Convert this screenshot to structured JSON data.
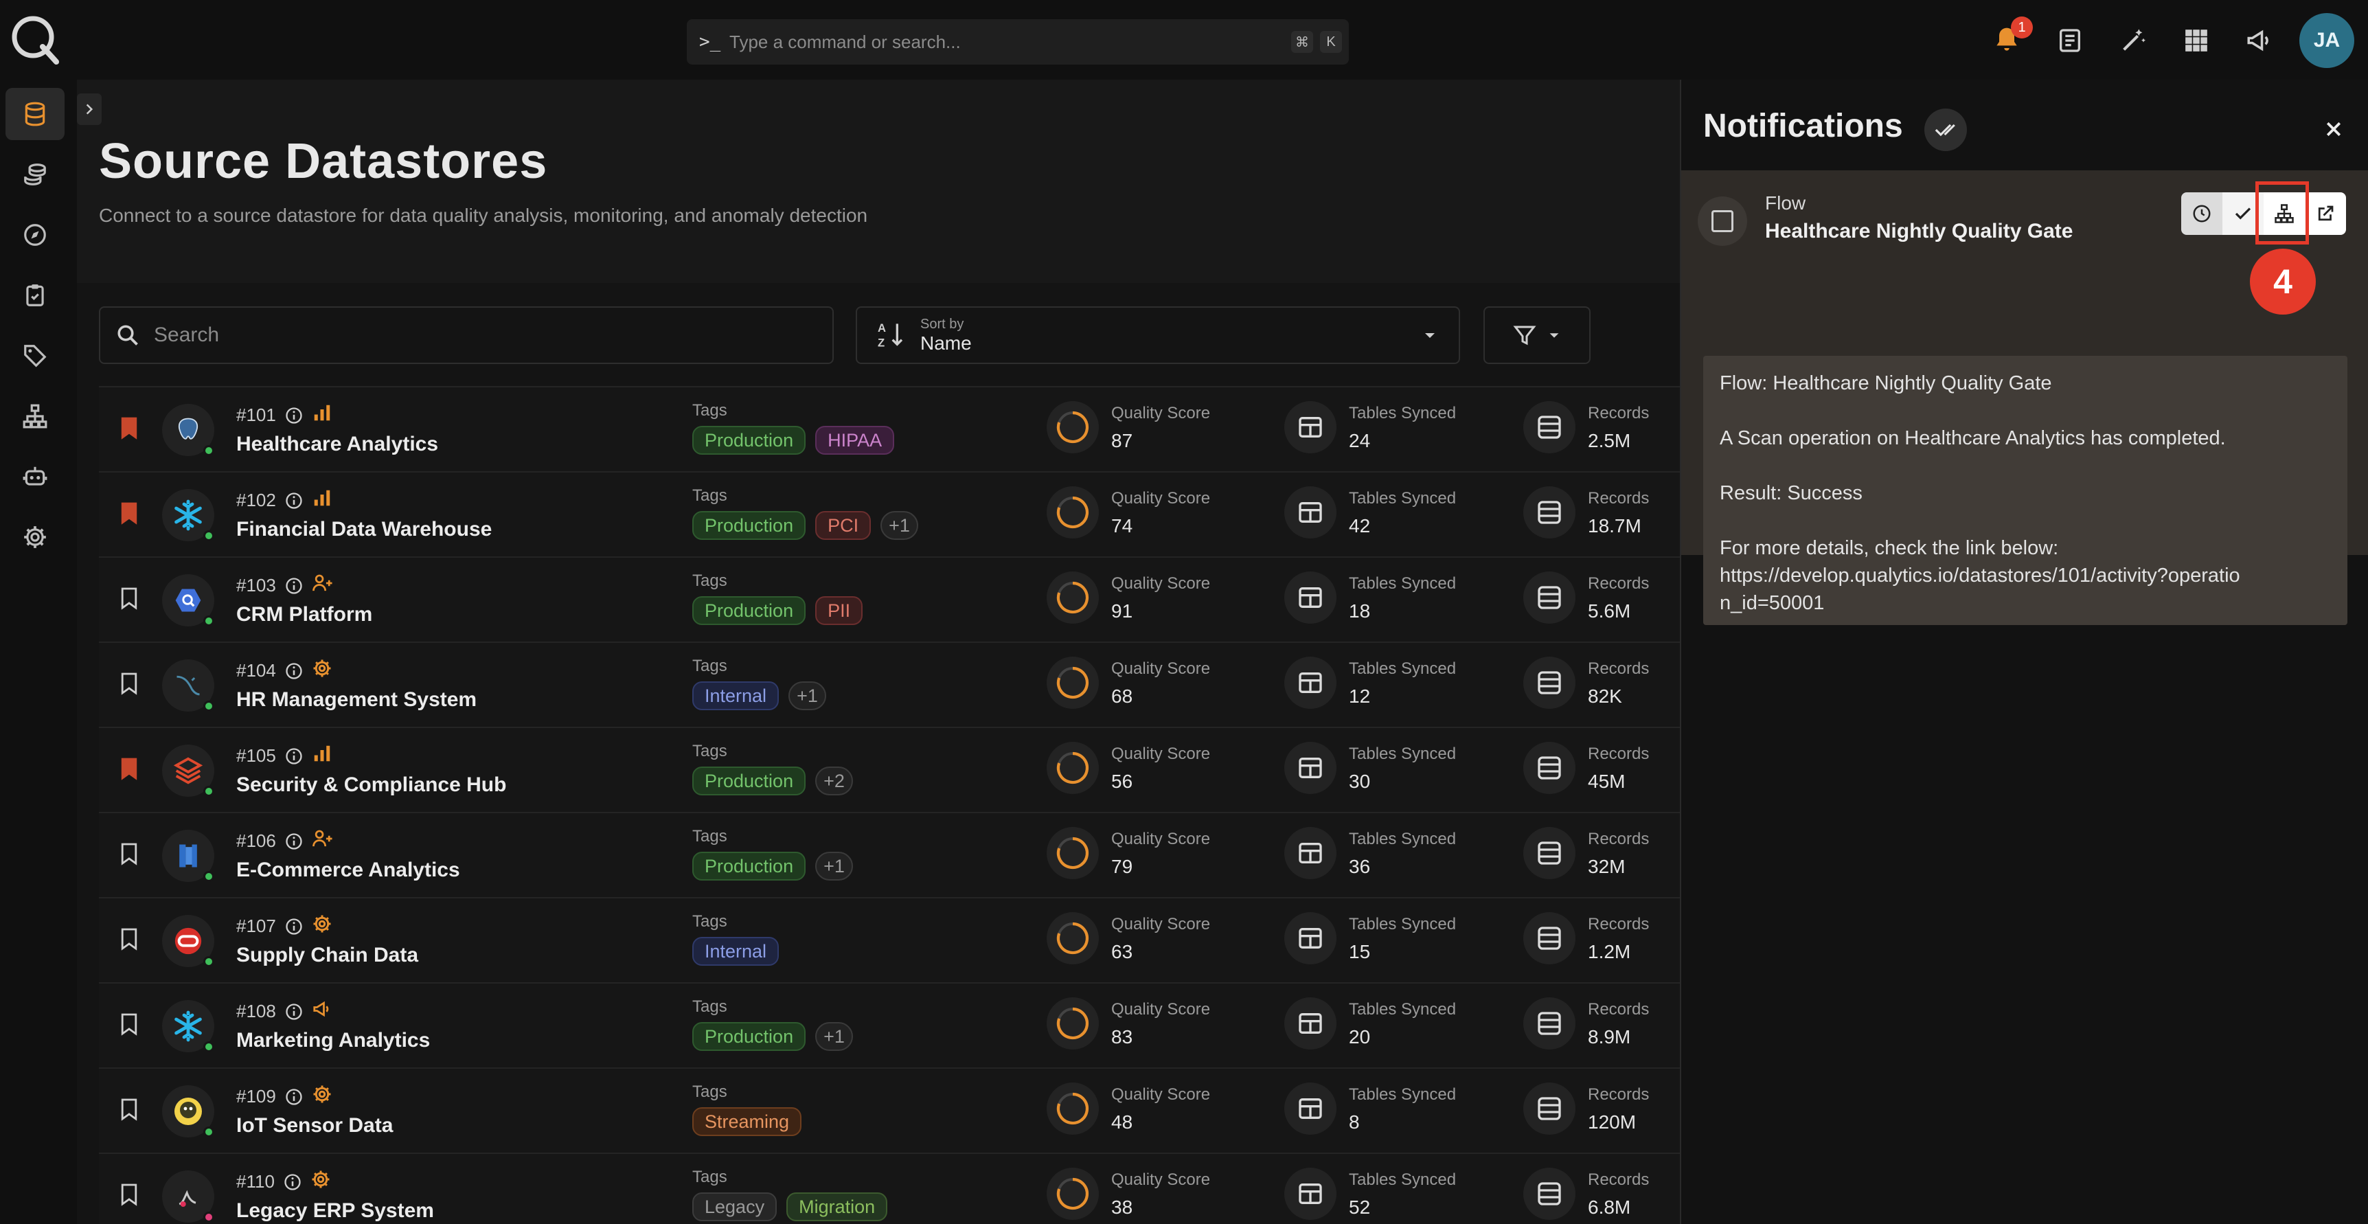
{
  "app": {
    "command_placeholder": "Type a command or search...",
    "kbd_cmd": "⌘",
    "kbd_k": "K",
    "notification_count": "1",
    "avatar_initials": "JA"
  },
  "page": {
    "title": "Source Datastores",
    "subtitle": "Connect to a source datastore for data quality analysis, monitoring, and anomaly detection",
    "search_placeholder": "Search",
    "sort_label": "Sort by",
    "sort_value": "Name"
  },
  "labels": {
    "tags": "Tags",
    "quality_score": "Quality Score",
    "tables_synced": "Tables Synced",
    "records": "Records"
  },
  "datastores": [
    {
      "id": "#101",
      "name": "Healthcare Analytics",
      "bookmarked": true,
      "logo": "postgres",
      "status": "#3fbf5a",
      "type_icon": "bar",
      "tags": [
        {
          "label": "Production",
          "cls": "tag-production"
        },
        {
          "label": "HIPAA",
          "cls": "tag-hipaa"
        }
      ],
      "quality": "87",
      "tables": "24",
      "records": "2.5M"
    },
    {
      "id": "#102",
      "name": "Financial Data Warehouse",
      "bookmarked": true,
      "logo": "snowflake",
      "status": "#3fbf5a",
      "type_icon": "bar",
      "tags": [
        {
          "label": "Production",
          "cls": "tag-production"
        },
        {
          "label": "PCI",
          "cls": "tag-pci"
        },
        {
          "label": "+1",
          "cls": "tag-more"
        }
      ],
      "quality": "74",
      "tables": "42",
      "records": "18.7M"
    },
    {
      "id": "#103",
      "name": "CRM Platform",
      "bookmarked": false,
      "logo": "bigquery",
      "status": "#3fbf5a",
      "type_icon": "user",
      "tags": [
        {
          "label": "Production",
          "cls": "tag-production"
        },
        {
          "label": "PII",
          "cls": "tag-pii"
        }
      ],
      "quality": "91",
      "tables": "18",
      "records": "5.6M"
    },
    {
      "id": "#104",
      "name": "HR Management System",
      "bookmarked": false,
      "logo": "mysql",
      "status": "#3fbf5a",
      "type_icon": "gear",
      "tags": [
        {
          "label": "Internal",
          "cls": "tag-internal"
        },
        {
          "label": "+1",
          "cls": "tag-more"
        }
      ],
      "quality": "68",
      "tables": "12",
      "records": "82K"
    },
    {
      "id": "#105",
      "name": "Security & Compliance Hub",
      "bookmarked": true,
      "logo": "databricks",
      "status": "#3fbf5a",
      "type_icon": "bar",
      "tags": [
        {
          "label": "Production",
          "cls": "tag-production"
        },
        {
          "label": "+2",
          "cls": "tag-more"
        }
      ],
      "quality": "56",
      "tables": "30",
      "records": "45M"
    },
    {
      "id": "#106",
      "name": "E-Commerce Analytics",
      "bookmarked": false,
      "logo": "redshift",
      "status": "#3fbf5a",
      "type_icon": "user",
      "tags": [
        {
          "label": "Production",
          "cls": "tag-production"
        },
        {
          "label": "+1",
          "cls": "tag-more"
        }
      ],
      "quality": "79",
      "tables": "36",
      "records": "32M"
    },
    {
      "id": "#107",
      "name": "Supply Chain Data",
      "bookmarked": false,
      "logo": "oracle",
      "status": "#3fbf5a",
      "type_icon": "gear",
      "tags": [
        {
          "label": "Internal",
          "cls": "tag-internal"
        }
      ],
      "quality": "63",
      "tables": "15",
      "records": "1.2M"
    },
    {
      "id": "#108",
      "name": "Marketing Analytics",
      "bookmarked": false,
      "logo": "snowflake",
      "status": "#3fbf5a",
      "type_icon": "megaphone",
      "tags": [
        {
          "label": "Production",
          "cls": "tag-production"
        },
        {
          "label": "+1",
          "cls": "tag-more"
        }
      ],
      "quality": "83",
      "tables": "20",
      "records": "8.9M"
    },
    {
      "id": "#109",
      "name": "IoT Sensor Data",
      "bookmarked": false,
      "logo": "hive",
      "status": "#3fbf5a",
      "type_icon": "gear",
      "tags": [
        {
          "label": "Streaming",
          "cls": "tag-streaming"
        }
      ],
      "quality": "48",
      "tables": "8",
      "records": "120M"
    },
    {
      "id": "#110",
      "name": "Legacy ERP System",
      "bookmarked": false,
      "logo": "db2",
      "status": "#e0407a",
      "type_icon": "gear",
      "tags": [
        {
          "label": "Legacy",
          "cls": "tag-legacy"
        },
        {
          "label": "Migration",
          "cls": "tag-migration"
        }
      ],
      "quality": "38",
      "tables": "52",
      "records": "6.8M"
    }
  ],
  "notifications": {
    "title": "Notifications",
    "item": {
      "type": "Flow",
      "title": "Healthcare Nightly Quality Gate",
      "body": [
        "Flow: Healthcare Nightly Quality Gate",
        "A Scan operation on Healthcare Analytics has completed.",
        "Result: Success",
        "For more details, check the link below:"
      ],
      "link": "https://develop.qualytics.io/datastores/101/activity?operation_id=50001"
    }
  },
  "annotation": {
    "step": "4",
    "color": "#e53a2a"
  }
}
